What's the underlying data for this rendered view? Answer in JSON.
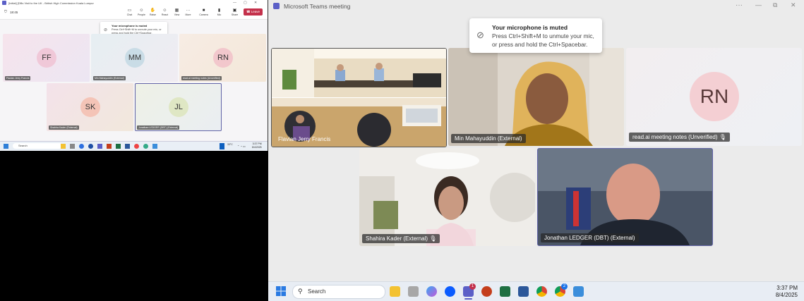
{
  "left_screen": {
    "title": "[Initial] [DBs Visit to the UK - British High Commission Kuala Lumpur",
    "timer": "18:45",
    "toolbar": [
      {
        "label": "Chat",
        "icon": "chat-icon"
      },
      {
        "label": "People",
        "icon": "people-icon"
      },
      {
        "label": "Raise",
        "icon": "raise-hand-icon"
      },
      {
        "label": "React",
        "icon": "react-icon"
      },
      {
        "label": "View",
        "icon": "view-icon"
      },
      {
        "label": "More",
        "icon": "more-icon"
      },
      {
        "label": "Camera",
        "icon": "camera-icon"
      },
      {
        "label": "Mic",
        "icon": "mic-icon"
      },
      {
        "label": "Share",
        "icon": "share-icon"
      }
    ],
    "leave_label": "Leave",
    "toast": {
      "title": "Your microphone is muted",
      "body": "Press Ctrl+Shift+M to unmute your mic, or press and hold the Ctrl+Spacebar."
    },
    "tiles": [
      {
        "initials": "FF",
        "name": "Flavian Jerry Francis",
        "color": "#f0c8d8"
      },
      {
        "initials": "MM",
        "name": "Min Mahayuddin (External)",
        "color": "#c9dce6"
      },
      {
        "initials": "RN",
        "name": "read.ai meeting notes (Unverified)",
        "color": "#f2c7cc"
      },
      {
        "initials": "SK",
        "name": "Shahira Kader (External)",
        "color": "#f4c4b7"
      },
      {
        "initials": "JL",
        "name": "Jonathan LEDGER (DBT) (External)",
        "color": "#dfe7c4"
      }
    ],
    "taskbar": {
      "search": "Search",
      "time": "3:37 PM",
      "date": "8/4/2025",
      "weather": "33°C"
    }
  },
  "right_screen": {
    "window_title": "Microsoft Teams meeting",
    "toast": {
      "title": "Your microphone is muted",
      "body": "Press Ctrl+Shift+M to unmute your mic, or press and hold the Ctrl+Spacebar."
    },
    "tiles": [
      {
        "name": "Flavian Jerry Francis",
        "type": "video"
      },
      {
        "name": "Min Mahayuddin (External)",
        "type": "video"
      },
      {
        "name": "read.ai meeting notes (Unverified)",
        "initials": "RN",
        "type": "avatar",
        "muted": true
      },
      {
        "name": "Shahira Kader (External)",
        "type": "video",
        "muted": true
      },
      {
        "name": "Jonathan LEDGER (DBT) (External)",
        "type": "video",
        "active": true
      }
    ],
    "taskbar": {
      "search": "Search",
      "time": "3:37 PM",
      "date": "8/4/2025",
      "teams_badge": "1",
      "chrome_badge": "2"
    }
  },
  "colors": {
    "leave": "#c4314b",
    "accent": "#6264a7",
    "teams": "#5b5fc7",
    "avatar_rn": "#f4cfd3"
  }
}
